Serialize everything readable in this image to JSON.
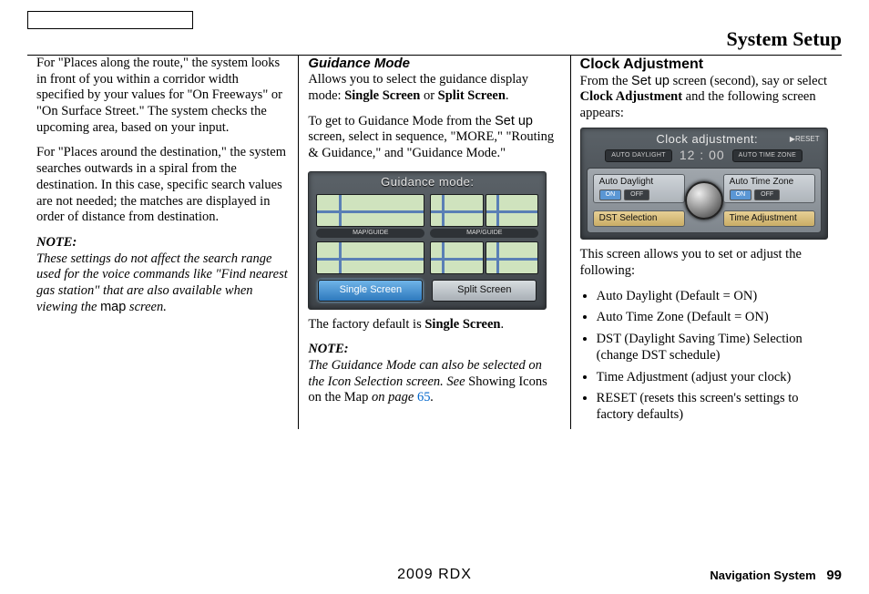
{
  "header": {
    "title": "System Setup"
  },
  "col1": {
    "p1": "For \"Places along the route,\" the system looks in front of you within a corridor width specified by your values for \"On Freeways\" or \"On Surface Street.\" The system checks the upcoming area, based on your input.",
    "p2": "For \"Places around the destination,\" the system searches outwards in a spiral from the destination. In this case, specific search values are not needed; the matches are displayed in order of distance from destination.",
    "note_label": "NOTE:",
    "note_text_a": "These settings do not affect the search range used for the voice commands like \"Find nearest gas station\" that are also available when viewing the ",
    "note_text_b": " screen.",
    "note_map_word": "map"
  },
  "col2": {
    "heading": "Guidance Mode",
    "p1a": "Allows you to select the guidance display mode: ",
    "p1b": "Single Screen",
    "p1c": " or ",
    "p1d": "Split Screen",
    "p1e": ".",
    "p2a": "To get to Guidance Mode from the ",
    "p2_setup": "Set up",
    "p2b": " screen, select in sequence, \"MORE,\" \"Routing & Guidance,\" and \"Guidance Mode.\"",
    "screenshot": {
      "title": "Guidance mode:",
      "map_guide": "MAP/GUIDE",
      "btn_single": "Single Screen",
      "btn_split": "Split Screen"
    },
    "p3a": "The factory default is ",
    "p3b": "Single Screen",
    "p3c": ".",
    "note_label": "NOTE:",
    "note_a": "The Guidance Mode can also be selected on the Icon Selection screen. See ",
    "note_b": "Showing Icons on the Map",
    "note_c": " on page ",
    "note_page": "65",
    "note_d": "."
  },
  "col3": {
    "heading": "Clock Adjustment",
    "p1a": "From the ",
    "p1_setup": "Set up",
    "p1b": " screen (second), say or select ",
    "p1c": "Clock Adjustment",
    "p1d": " and the following screen appears:",
    "screenshot": {
      "title": "Clock adjustment:",
      "reset": "▶RESET",
      "status_daylight": "AUTO DAYLIGHT",
      "status_time": "12 : 00",
      "status_zone": "AUTO TIME ZONE",
      "auto_daylight": "Auto Daylight",
      "auto_timezone": "Auto Time Zone",
      "on": "ON",
      "off": "OFF",
      "dst": "DST Selection",
      "time_adj": "Time Adjustment"
    },
    "p2": "This screen allows you to set or adjust the following:",
    "bullets": [
      "Auto Daylight (Default = ON)",
      "Auto Time Zone (Default = ON)",
      "DST (Daylight Saving Time) Selection (change DST schedule)",
      "Time Adjustment (adjust your clock)",
      "RESET (resets this screen's settings to factory defaults)"
    ]
  },
  "footer": {
    "center": "2009  RDX",
    "label": "Navigation System",
    "page": "99"
  }
}
